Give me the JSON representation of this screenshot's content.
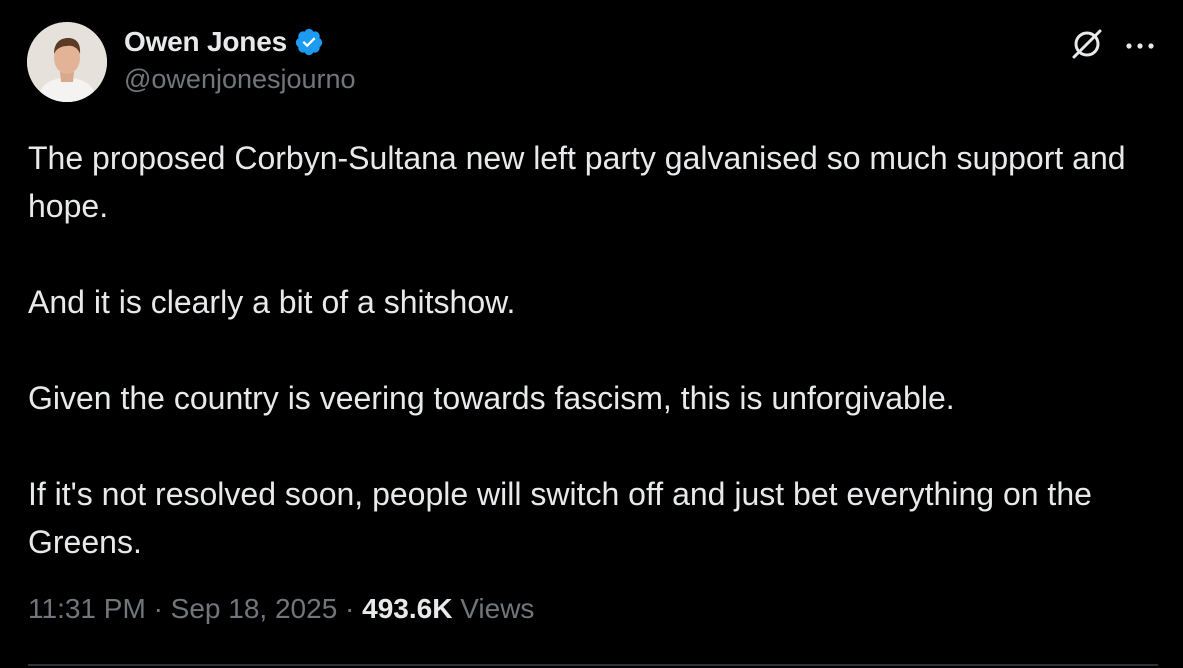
{
  "author": {
    "display_name": "Owen Jones",
    "handle": "@owenjonesjourno",
    "verified": true,
    "avatar_icon": "profile-photo"
  },
  "tweet": {
    "paragraphs": [
      "The proposed Corbyn-Sultana new left party galvanised so much support and hope.",
      "And it is clearly a bit of a shitshow.",
      "Given the country is veering towards fascism, this is unforgivable.",
      "If it's not resolved soon, people will switch off and just bet everything on the Greens."
    ]
  },
  "meta": {
    "time": "11:31 PM",
    "separator": "·",
    "date": "Sep 18, 2025",
    "views_count": "493.6K",
    "views_label": "Views"
  },
  "icons": {
    "verified": "verified-badge-icon",
    "grok": "grok-icon",
    "more": "more-options-icon"
  },
  "colors": {
    "background": "#000000",
    "primary_text": "#e7e9ea",
    "secondary_text": "#71767b",
    "verified_blue": "#1d9bf0"
  }
}
